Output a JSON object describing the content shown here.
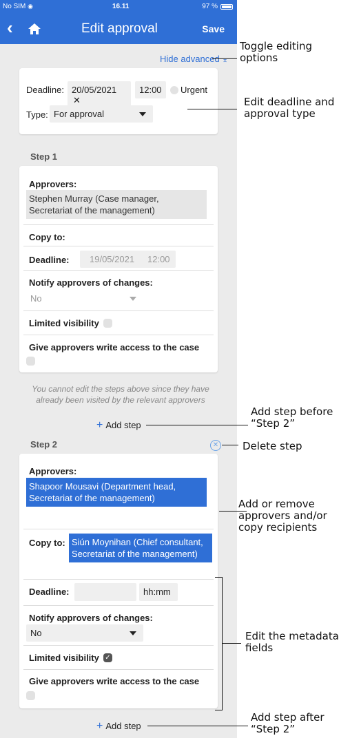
{
  "status": {
    "carrier": "No SIM",
    "time": "16.11",
    "battery": "97 %"
  },
  "nav": {
    "title": "Edit approval",
    "save": "Save"
  },
  "hide_advanced": "Hide advanced",
  "top": {
    "deadline_label": "Deadline:",
    "deadline_date": "20/05/2021",
    "deadline_clear": "✕",
    "deadline_time": "12:00",
    "urgent": "Urgent",
    "type_label": "Type:",
    "type_value": "For approval"
  },
  "step1": {
    "title": "Step 1",
    "approvers_label": "Approvers:",
    "approver": "Stephen Murray (Case manager, Secretariat of the management)",
    "copy_label": "Copy to:",
    "deadline_label": "Deadline:",
    "deadline_date": "19/05/2021",
    "deadline_time": "12:00",
    "notify_label": "Notify approvers of changes:",
    "notify_value": "No",
    "limited": "Limited visibility",
    "write_access": "Give approvers write access to the case"
  },
  "note": "You cannot edit the steps above since they have already been visited by the relevant approvers",
  "add_step": "Add step",
  "step2": {
    "title": "Step 2",
    "approvers_label": "Approvers:",
    "approver": "Shapoor Mousavi (Department head, Secretariat of the management)",
    "copy_label": "Copy to:",
    "copy_value": "Siún Moynihan (Chief consultant, Secretariat of the management)",
    "deadline_label": "Deadline:",
    "deadline_time_placeholder": "hh:mm",
    "notify_label": "Notify approvers of changes:",
    "notify_value": "No",
    "limited": "Limited visibility",
    "write_access": "Give approvers write access to the case"
  },
  "annotations": {
    "toggle": "Toggle editing options",
    "edit_deadline": "Edit deadline and approval type",
    "add_before": "Add step before “Step 2”",
    "delete": "Delete step",
    "add_remove": "Add or remove approvers and/or copy recipients",
    "metadata": "Edit the metadata fields",
    "add_after": "Add step after “Step 2”"
  },
  "colors": {
    "accent": "#2f6fd6",
    "background": "#ebebeb"
  }
}
